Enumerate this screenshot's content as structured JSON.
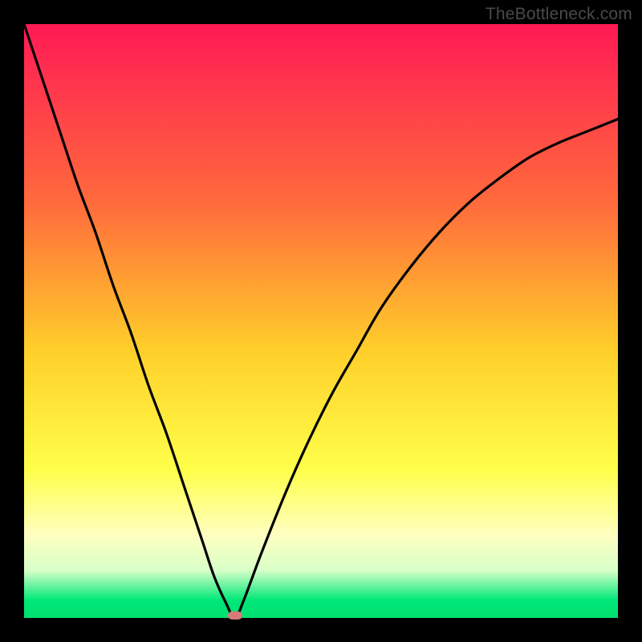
{
  "watermark": "TheBottleneck.com",
  "chart_data": {
    "type": "line",
    "title": "",
    "xlabel": "",
    "ylabel": "",
    "xlim": [
      0,
      100
    ],
    "ylim": [
      0,
      100
    ],
    "gradient_stops": [
      {
        "offset": 0,
        "color": "#ff1a55"
      },
      {
        "offset": 30,
        "color": "#ff6a3c"
      },
      {
        "offset": 55,
        "color": "#ffcf2a"
      },
      {
        "offset": 75,
        "color": "#ffff4a"
      },
      {
        "offset": 86,
        "color": "#ffffc0"
      },
      {
        "offset": 92,
        "color": "#d8ffc8"
      },
      {
        "offset": 97,
        "color": "#00e878"
      },
      {
        "offset": 100,
        "color": "#00e070"
      }
    ],
    "series": [
      {
        "name": "bottleneck-curve",
        "x": [
          0,
          3,
          6,
          9,
          12,
          15,
          18,
          21,
          24,
          27,
          30,
          32,
          34,
          35.5,
          37,
          40,
          44,
          48,
          52,
          56,
          60,
          65,
          70,
          75,
          80,
          85,
          90,
          95,
          100
        ],
        "y": [
          100,
          91,
          82,
          73,
          65,
          56,
          48,
          39,
          31,
          22,
          13,
          7,
          2.5,
          0,
          3,
          11,
          21,
          30,
          38,
          45,
          52,
          59,
          65,
          70,
          74,
          77.5,
          80,
          82,
          84
        ]
      }
    ],
    "marker": {
      "x": 35.5,
      "y": 0,
      "color": "#d97a7a"
    }
  }
}
